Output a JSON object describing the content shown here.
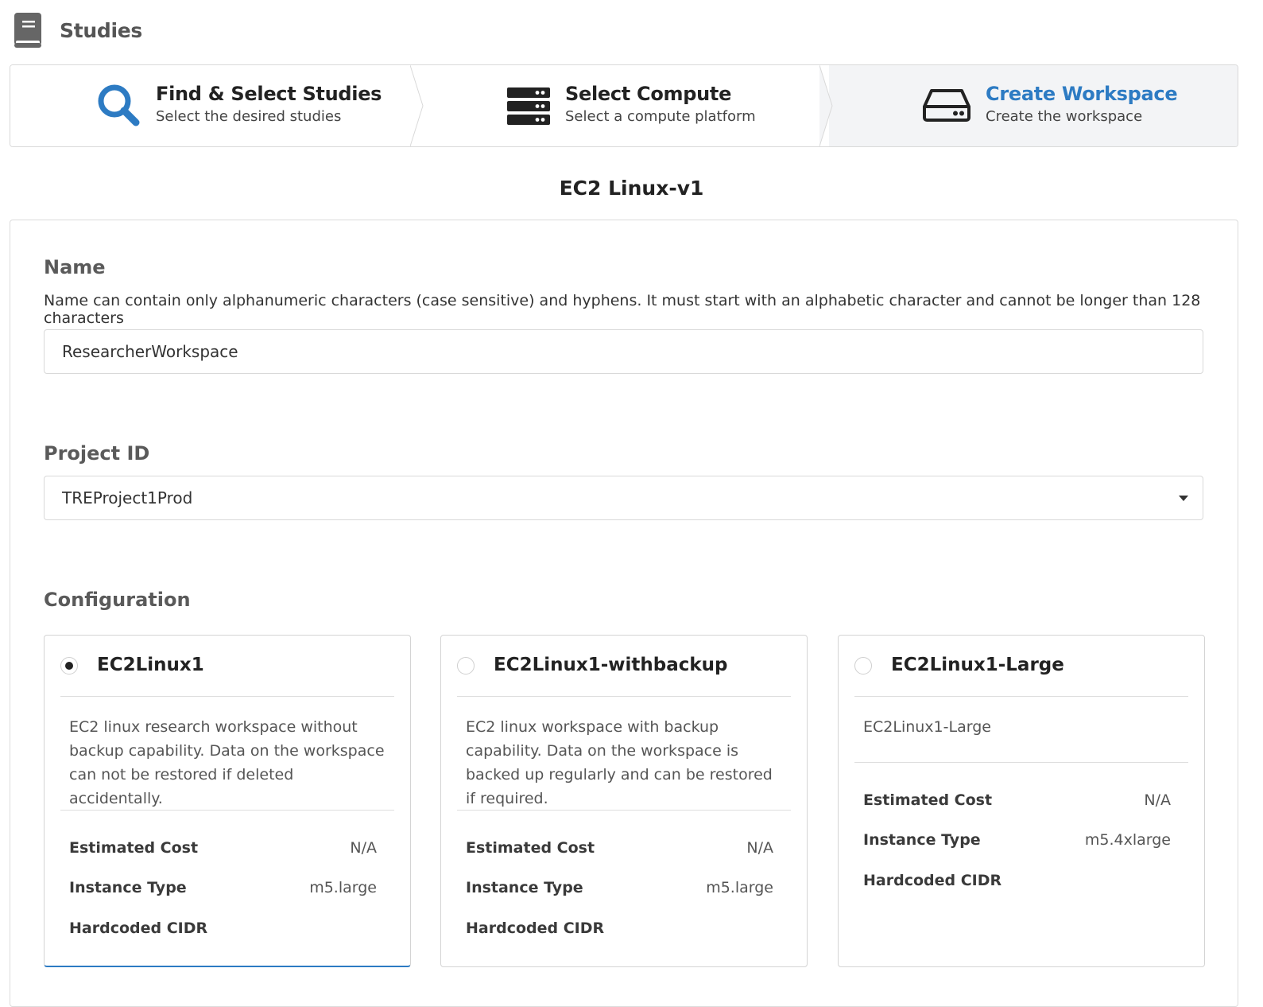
{
  "header": {
    "title": "Studies",
    "icon": "book-icon"
  },
  "steps": [
    {
      "title": "Find & Select Studies",
      "desc": "Select the desired studies",
      "icon": "search-icon",
      "active": false
    },
    {
      "title": "Select Compute",
      "desc": "Select a compute platform",
      "icon": "server-icon",
      "active": false
    },
    {
      "title": "Create Workspace",
      "desc": "Create the workspace",
      "icon": "hard-drive-icon",
      "active": true
    }
  ],
  "page_title": "EC2 Linux-v1",
  "form": {
    "name": {
      "label": "Name",
      "help": "Name can contain only alphanumeric characters (case sensitive) and hyphens. It must start with an alphabetic character and cannot be longer than 128 characters",
      "value": "ResearcherWorkspace"
    },
    "project": {
      "label": "Project ID",
      "value": "TREProject1Prod"
    },
    "configuration": {
      "label": "Configuration",
      "cards": [
        {
          "name": "EC2Linux1",
          "selected": true,
          "desc": "EC2 linux research workspace without backup capability. Data on the workspace can not be restored if deleted accidentally.",
          "cost_label": "Estimated Cost",
          "cost": "N/A",
          "instance_label": "Instance Type",
          "instance": "m5.large",
          "cidr_label": "Hardcoded CIDR",
          "cidr": ""
        },
        {
          "name": "EC2Linux1-withbackup",
          "selected": false,
          "desc": "EC2 linux workspace with backup capability. Data on the workspace is backed up regularly and can be restored if required.",
          "cost_label": "Estimated Cost",
          "cost": "N/A",
          "instance_label": "Instance Type",
          "instance": "m5.large",
          "cidr_label": "Hardcoded CIDR",
          "cidr": ""
        },
        {
          "name": "EC2Linux1-Large",
          "selected": false,
          "desc": "EC2Linux1-Large",
          "cost_label": "Estimated Cost",
          "cost": "N/A",
          "instance_label": "Instance Type",
          "instance": "m5.4xlarge",
          "cidr_label": "Hardcoded CIDR",
          "cidr": ""
        }
      ]
    }
  },
  "colors": {
    "accent": "#2d7bc3",
    "active_step_bg": "#f3f4f6"
  }
}
